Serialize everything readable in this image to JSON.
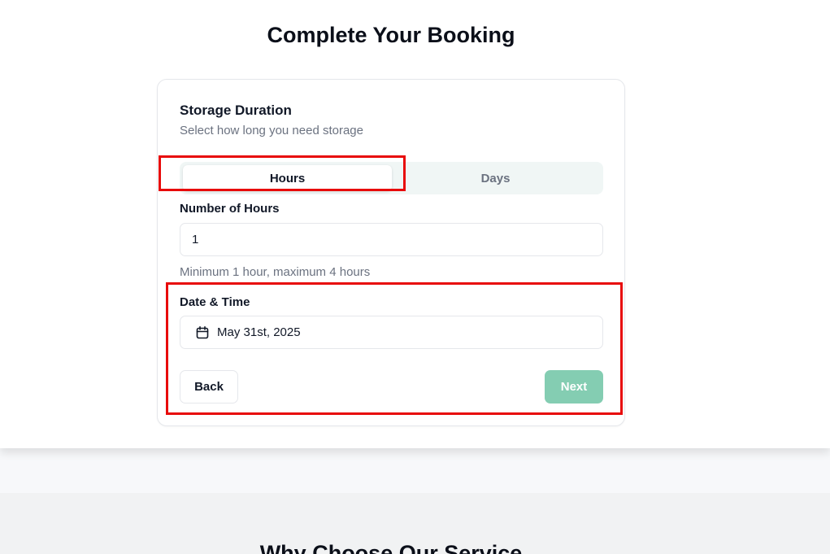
{
  "page": {
    "title": "Complete Your Booking"
  },
  "storage": {
    "title": "Storage Duration",
    "subtitle": "Select how long you need storage",
    "toggle": {
      "options": [
        "Hours",
        "Days"
      ],
      "selected": "Hours"
    }
  },
  "hours_field": {
    "label": "Number of Hours",
    "value": "1",
    "hint": "Minimum 1 hour, maximum 4 hours"
  },
  "date_field": {
    "label": "Date & Time",
    "value": "May 31st, 2025",
    "icon": "calendar-icon"
  },
  "actions": {
    "back_label": "Back",
    "next_label": "Next"
  },
  "next_section": {
    "heading": "Why Choose Our Service"
  },
  "colors": {
    "accent": "#84cdb2",
    "highlight": "#e80a0a",
    "toggle_track": "#f0f6f5"
  }
}
